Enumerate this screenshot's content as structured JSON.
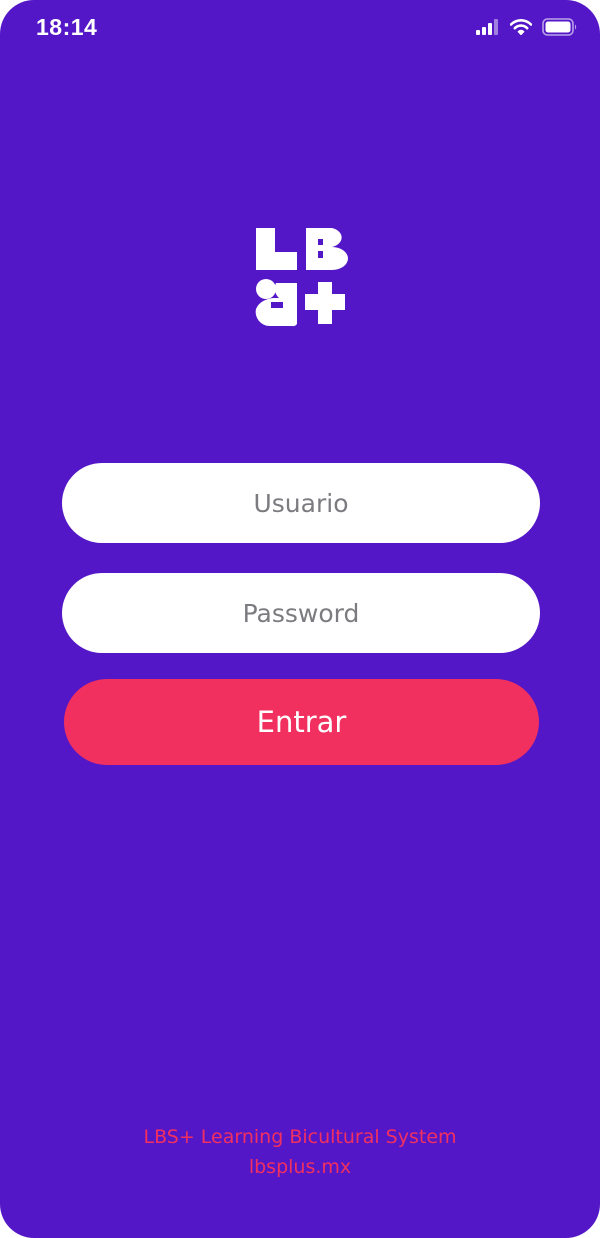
{
  "status_bar": {
    "time": "18:14",
    "icons": [
      "signal-icon",
      "wifi-icon",
      "battery-icon"
    ]
  },
  "brand": {
    "logo_icon": "lbs-plus-logo",
    "logo_text": "LBS+"
  },
  "login_form": {
    "username_placeholder": "Usuario",
    "username_value": "",
    "password_placeholder": "Password",
    "password_value": "",
    "submit_label": "Entrar"
  },
  "footer": {
    "tagline": "LBS+ Learning Bicultural System",
    "website": "lbsplus.mx"
  },
  "colors": {
    "background": "#5317c7",
    "accent": "#f2305f",
    "field_background": "#ffffff",
    "placeholder": "#7b7b80"
  }
}
